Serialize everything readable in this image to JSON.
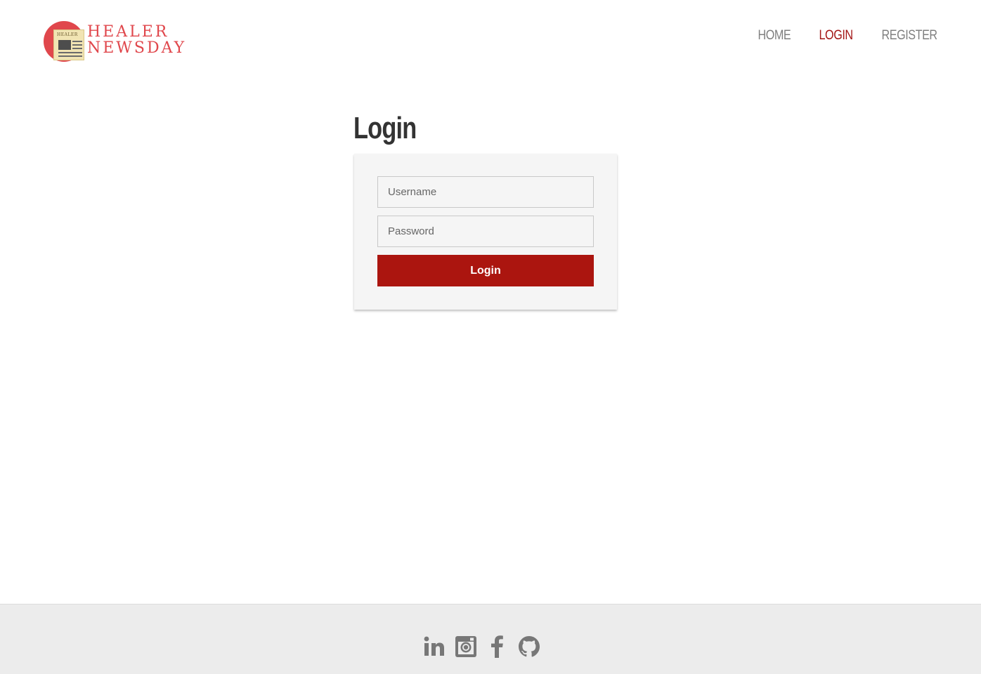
{
  "brand": {
    "line1": "HEALER",
    "line2": "NEWSDAY",
    "paper_text": "HEALER",
    "color": "#e0474c"
  },
  "nav": {
    "items": [
      {
        "label": "HOME",
        "active": false
      },
      {
        "label": "LOGIN",
        "active": true
      },
      {
        "label": "REGISTER",
        "active": false
      }
    ]
  },
  "main": {
    "title": "Login",
    "form": {
      "username_placeholder": "Username",
      "username_value": "",
      "password_placeholder": "Password",
      "password_value": "",
      "submit_label": "Login"
    }
  },
  "footer": {
    "social_icons": [
      "linkedin-icon",
      "instagram-icon",
      "facebook-icon",
      "github-icon"
    ]
  },
  "colors": {
    "accent": "#ab150f",
    "nav_active": "#a31515",
    "nav_inactive": "#7f7f7f",
    "footer_bg": "#ececec",
    "icon_gray": "#777777"
  }
}
